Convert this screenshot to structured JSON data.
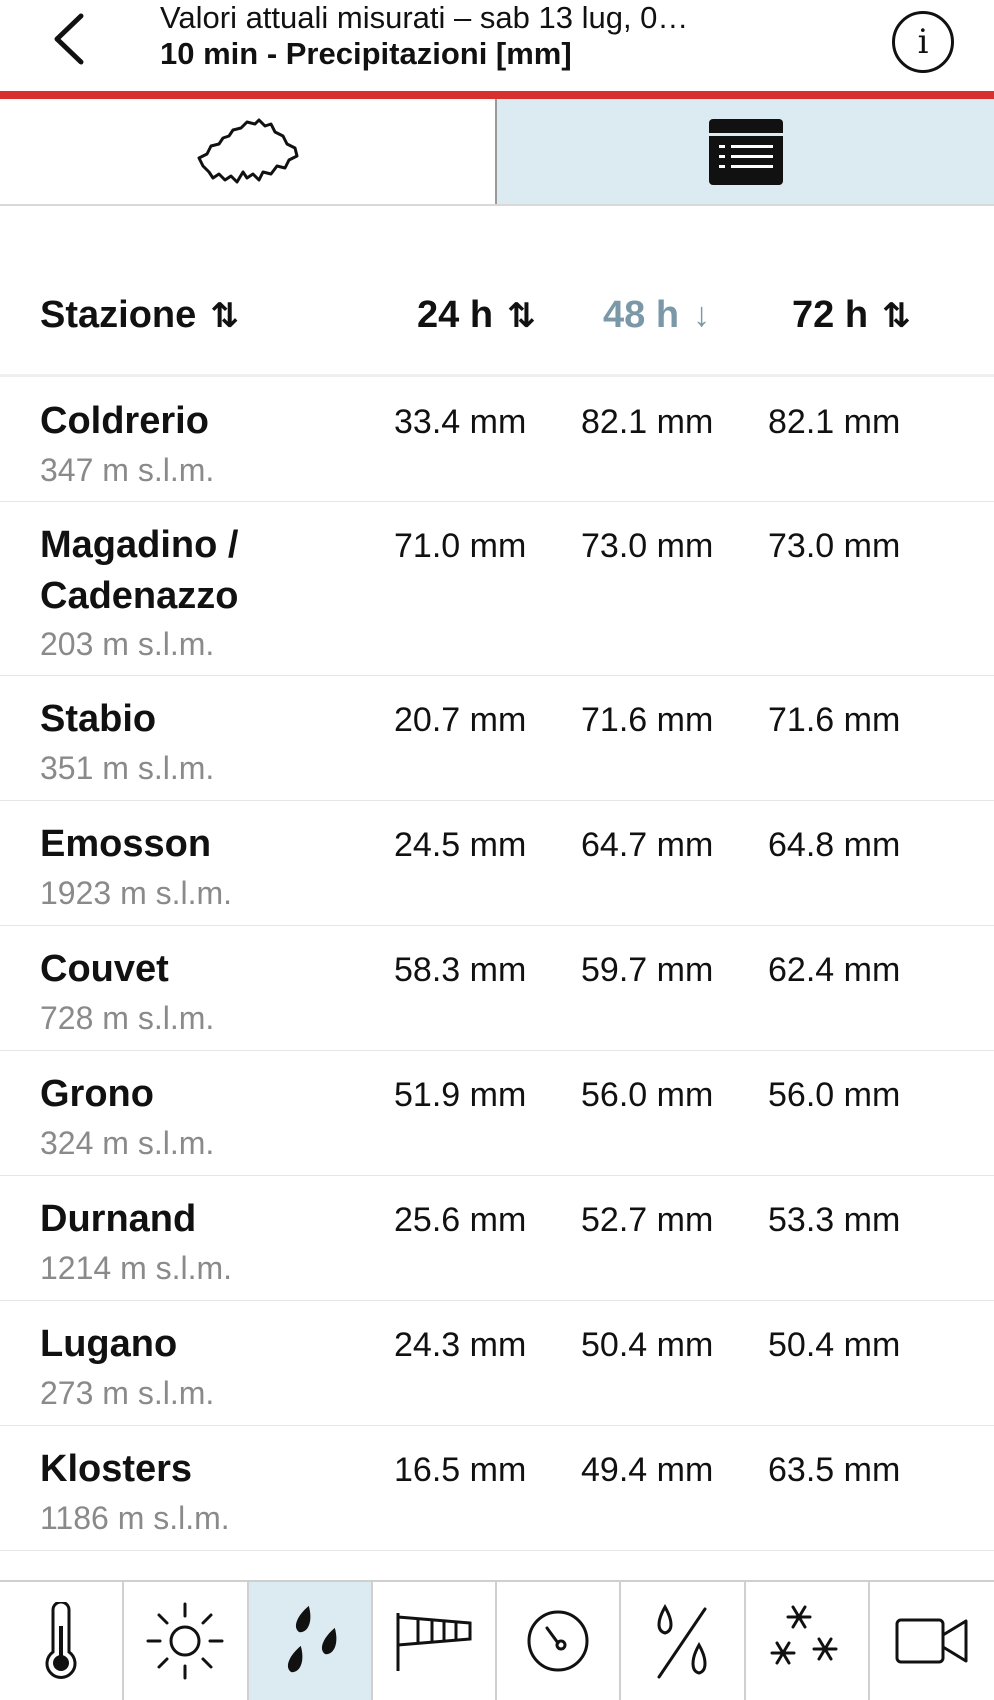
{
  "header": {
    "title_line1": "Valori attuali misurati – sab 13 lug, 0…",
    "title_line2": "10 min - Precipitazioni [mm]",
    "info_label": "i"
  },
  "view_switch": {
    "options": [
      "map-view",
      "list-view"
    ],
    "selected": "list-view"
  },
  "columns": {
    "station": "Stazione",
    "h24": "24 h",
    "h48": "48 h",
    "h72": "72 h",
    "sort_both_glyph": "⇅",
    "sort_down_glyph": "↓",
    "active_sort": "h48",
    "active_color": "#7a98a8"
  },
  "rows": [
    {
      "name": "Coldrerio",
      "altitude": "347 m s.l.m.",
      "h24": "33.4 mm",
      "h48": "82.1 mm",
      "h72": "82.1 mm"
    },
    {
      "name": "Magadino / Cadenazzo",
      "altitude": "203 m s.l.m.",
      "h24": "71.0 mm",
      "h48": "73.0 mm",
      "h72": "73.0 mm"
    },
    {
      "name": "Stabio",
      "altitude": "351 m s.l.m.",
      "h24": "20.7 mm",
      "h48": "71.6 mm",
      "h72": "71.6 mm"
    },
    {
      "name": "Emosson",
      "altitude": "1923 m s.l.m.",
      "h24": "24.5 mm",
      "h48": "64.7 mm",
      "h72": "64.8 mm"
    },
    {
      "name": "Couvet",
      "altitude": "728 m s.l.m.",
      "h24": "58.3 mm",
      "h48": "59.7 mm",
      "h72": "62.4 mm"
    },
    {
      "name": "Grono",
      "altitude": "324 m s.l.m.",
      "h24": "51.9 mm",
      "h48": "56.0 mm",
      "h72": "56.0 mm"
    },
    {
      "name": "Durnand",
      "altitude": "1214 m s.l.m.",
      "h24": "25.6 mm",
      "h48": "52.7 mm",
      "h72": "53.3 mm"
    },
    {
      "name": "Lugano",
      "altitude": "273 m s.l.m.",
      "h24": "24.3 mm",
      "h48": "50.4 mm",
      "h72": "50.4 mm"
    },
    {
      "name": "Klosters",
      "altitude": "1186 m s.l.m.",
      "h24": "16.5 mm",
      "h48": "49.4 mm",
      "h72": "63.5 mm"
    }
  ],
  "tabbar": {
    "tabs": [
      "thermometer-icon",
      "sun-icon",
      "raindrops-icon",
      "windsock-icon",
      "pressure-gauge-icon",
      "humidity-icon",
      "snowflakes-icon",
      "camera-icon"
    ],
    "active": "raindrops-icon"
  },
  "colors": {
    "accent_red": "#d8302f",
    "selected_bg": "#dcebf1"
  }
}
